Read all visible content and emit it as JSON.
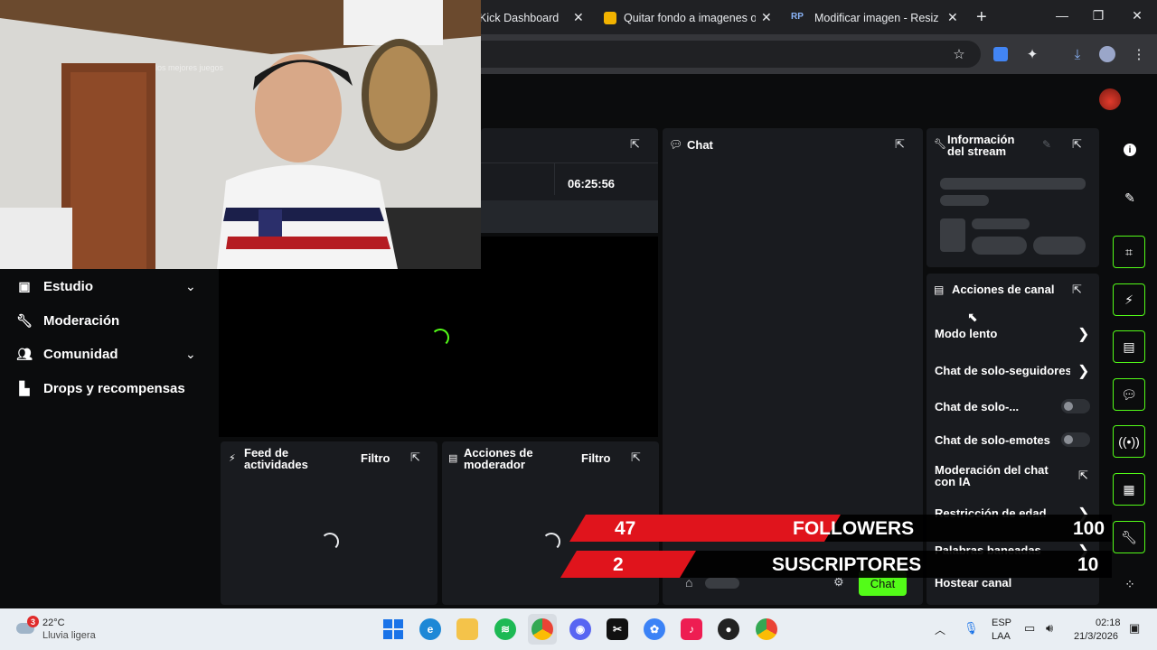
{
  "browser": {
    "tabs": [
      {
        "title": "Kick Dashboard"
      },
      {
        "title": "Quitar fondo a imagenes on"
      },
      {
        "title": "Modificar imagen - ResizePi"
      }
    ],
    "new_tab": "+",
    "close": "✕"
  },
  "nav": {
    "items": [
      {
        "label": "Estudio"
      },
      {
        "label": "Moderación"
      },
      {
        "label": "Comunidad"
      },
      {
        "label": "Drops y recompensas"
      }
    ]
  },
  "stream": {
    "timer": "06:25:56"
  },
  "chat": {
    "title": "Chat",
    "button": "Chat"
  },
  "info": {
    "title_line1": "Información",
    "title_line2": "del stream"
  },
  "actions": {
    "title": "Acciones de canal",
    "items": [
      {
        "label": "Modo lento"
      },
      {
        "label": "Chat de solo-seguidores"
      },
      {
        "label": "Chat de solo-..."
      },
      {
        "label": "Chat de solo-emotes"
      },
      {
        "label_line1": "Moderación del chat",
        "label_line2": "con IA"
      },
      {
        "label": "Restricción de edad"
      },
      {
        "label": "Palabras baneadas"
      },
      {
        "label": "Hostear canal"
      }
    ]
  },
  "feed": {
    "title_line1": "Feed de",
    "title_line2": "actividades",
    "filter": "Filtro"
  },
  "modactions": {
    "title_line1": "Acciones de",
    "title_line2": "moderador",
    "filter": "Filtro"
  },
  "overlay": {
    "followers": {
      "current": "47",
      "label": "FOLLOWERS",
      "goal": "100"
    },
    "subs": {
      "current": "2",
      "label": "SUSCRIPTORES",
      "goal": "10"
    },
    "accent_red": "#e0141c"
  },
  "webcam": {
    "watermark": "los mejores juegos"
  },
  "taskbar": {
    "weather_temp": "22°C",
    "weather_desc": "Lluvia ligera",
    "weather_badge": "3",
    "lang1": "ESP",
    "lang2": "LAA",
    "time": "02:18",
    "date": "21/3/2026"
  },
  "colors": {
    "kick_green": "#53fc18"
  }
}
